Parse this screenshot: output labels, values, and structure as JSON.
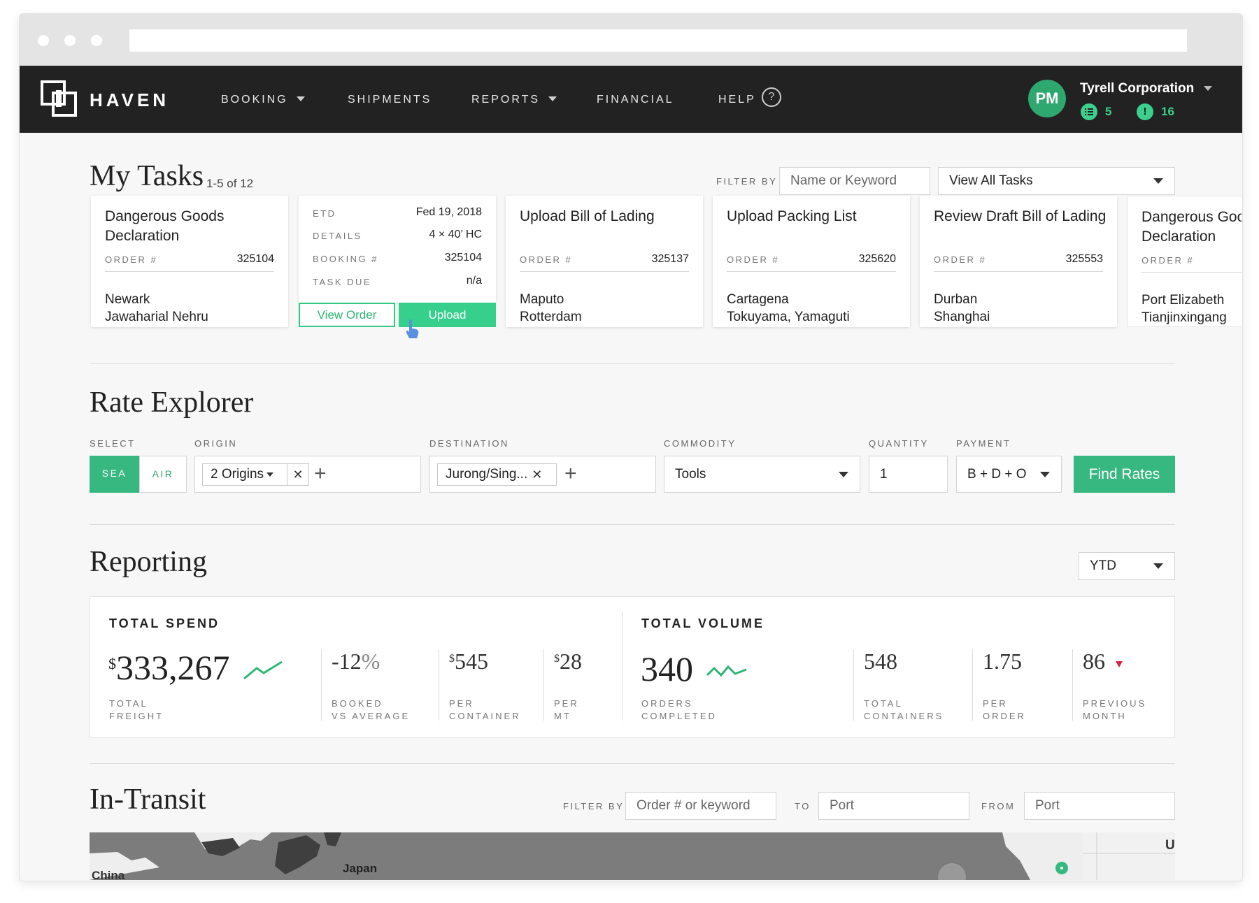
{
  "nav": {
    "brand": "HAVEN",
    "items": [
      "BOOKING",
      "SHIPMENTS",
      "REPORTS",
      "FINANCIAL",
      "HELP"
    ],
    "help_glyph": "?",
    "avatar_initials": "PM",
    "company": "Tyrell Corporation",
    "list_count": "5",
    "alert_count": "16",
    "accent": "#3ccf8e"
  },
  "tasks": {
    "title": "My Tasks",
    "count": "1-5 of 12",
    "filter_label": "FILTER BY",
    "filter_placeholder": "Name or Keyword",
    "view_select": "View All Tasks",
    "cards": [
      {
        "title": "Dangerous Goods Declaration",
        "order_label": "ORDER #",
        "order": "325104",
        "origin": "Newark",
        "destination": "Jawaharial Nehru"
      },
      {
        "etd_label": "ETD",
        "etd": "Fed 19, 2018",
        "details_label": "DETAILS",
        "details": "4 × 40’ HC",
        "booking_label": "BOOKING #",
        "booking": "325104",
        "due_label": "TASK DUE",
        "due": "n/a",
        "view_button": "View Order",
        "upload_button": "Upload"
      },
      {
        "title": "Upload Bill of Lading",
        "order_label": "ORDER #",
        "order": "325137",
        "origin": "Maputo",
        "destination": "Rotterdam"
      },
      {
        "title": "Upload Packing List",
        "order_label": "ORDER #",
        "order": "325620",
        "origin": "Cartagena",
        "destination": "Tokuyama, Yamaguti"
      },
      {
        "title": "Review Draft Bill of Lading",
        "order_label": "ORDER #",
        "order": "325553",
        "origin": "Durban",
        "destination": "Shanghai"
      },
      {
        "title": "Dangerous Goods Declaration",
        "order_label": "ORDER #",
        "order": "",
        "origin": "Port Elizabeth",
        "destination": "Tianjinxingang"
      }
    ]
  },
  "rates": {
    "title": "Rate Explorer",
    "select_label": "SELECT",
    "modes": [
      "SEA",
      "AIR"
    ],
    "origin_label": "ORIGIN",
    "origin_chip": "2 Origins",
    "destination_label": "DESTINATION",
    "destination_chip": "Jurong/Sing...",
    "commodity_label": "COMMODITY",
    "commodity": "Tools",
    "quantity_label": "QUANTITY",
    "quantity": "1",
    "payment_label": "PAYMENT",
    "payment": "B + D + O",
    "find_button": "Find Rates"
  },
  "reporting": {
    "title": "Reporting",
    "period": "YTD",
    "spend": {
      "title": "TOTAL SPEND",
      "total_currency": "$",
      "total": "333,267",
      "total_caption_1": "TOTAL",
      "total_caption_2": "FREIGHT",
      "booked": "-12",
      "booked_unit": "%",
      "booked_caption_1": "BOOKED",
      "booked_caption_2": "VS AVERAGE",
      "per_container_currency": "$",
      "per_container": "545",
      "per_container_caption_1": "PER",
      "per_container_caption_2": "CONTAINER",
      "per_mt_currency": "$",
      "per_mt": "28",
      "per_mt_caption_1": "PER",
      "per_mt_caption_2": "MT"
    },
    "volume": {
      "title": "TOTAL VOLUME",
      "orders": "340",
      "orders_caption_1": "ORDERS",
      "orders_caption_2": "COMPLETED",
      "containers": "548",
      "containers_caption_1": "TOTAL",
      "containers_caption_2": "CONTAINERS",
      "per_order": "1.75",
      "per_order_caption_1": "PER",
      "per_order_caption_2": "ORDER",
      "previous": "86",
      "previous_caption_1": "PREVIOUS",
      "previous_caption_2": "MONTH",
      "trend_down_color": "#d0274b"
    }
  },
  "transit": {
    "title": "In-Transit",
    "filter_label": "FILTER BY",
    "filter_placeholder": "Order # or keyword",
    "to_label": "TO",
    "to_placeholder": "Port",
    "from_label": "FROM",
    "from_placeholder": "Port",
    "map_labels": [
      "China",
      "Japan",
      "U"
    ]
  }
}
